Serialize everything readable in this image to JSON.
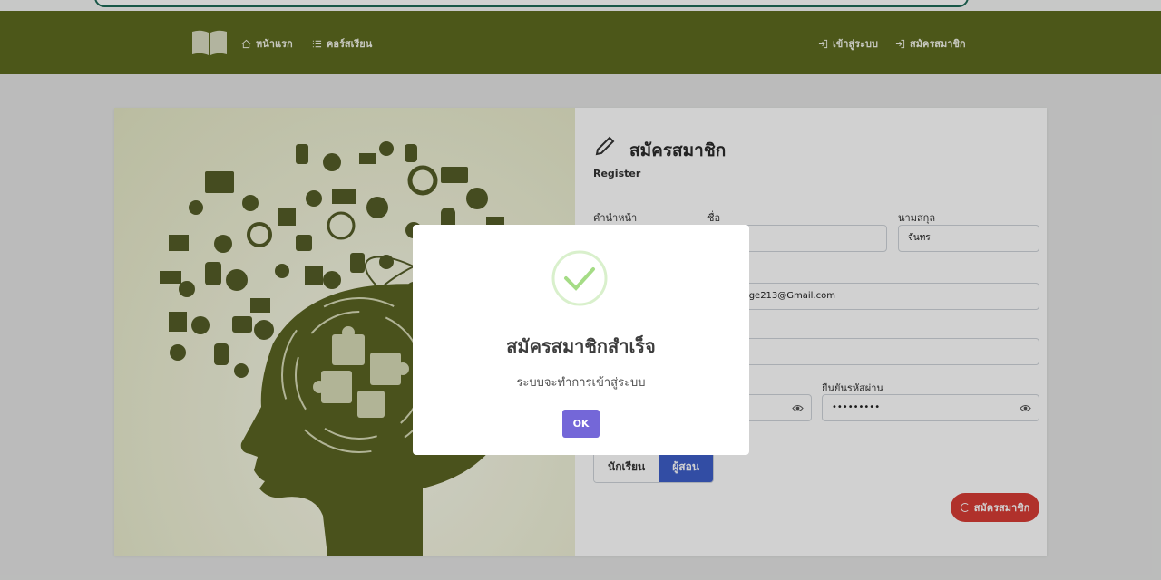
{
  "nav": {
    "home_label": "หน้าแรก",
    "courses_label": "คอร์สเรียน",
    "login_label": "เข้าสู่ระบบ",
    "register_label": "สมัครสมาชิก"
  },
  "form": {
    "title": "สมัครสมาชิก",
    "subtitle": "Register",
    "prefix_label": "คำนำหน้า",
    "firstname_label": "ชื่อ",
    "lastname_label": "นามสกุล",
    "lastname_value": "จันทร",
    "email_value": "vige213@Gmail.com",
    "confirm_password_label": "ยืนยันรหัสผ่าน",
    "password_masked": "••••••••",
    "confirm_password_masked": "•••••••••",
    "role_student": "นักเรียน",
    "role_teacher": "ผู้สอน",
    "submit_label": "สมัครสมาชิก"
  },
  "modal": {
    "title": "สมัครสมาชิกสำเร็จ",
    "message": "ระบบจะทำการเข้าสู่ระบบ",
    "ok_label": "OK"
  },
  "colors": {
    "navbar": "#5d6b1f",
    "accent_blue": "#3e5fc9",
    "submit_red": "#d73c35",
    "ok_purple": "#7467d8",
    "success_green": "#a5dc86"
  }
}
